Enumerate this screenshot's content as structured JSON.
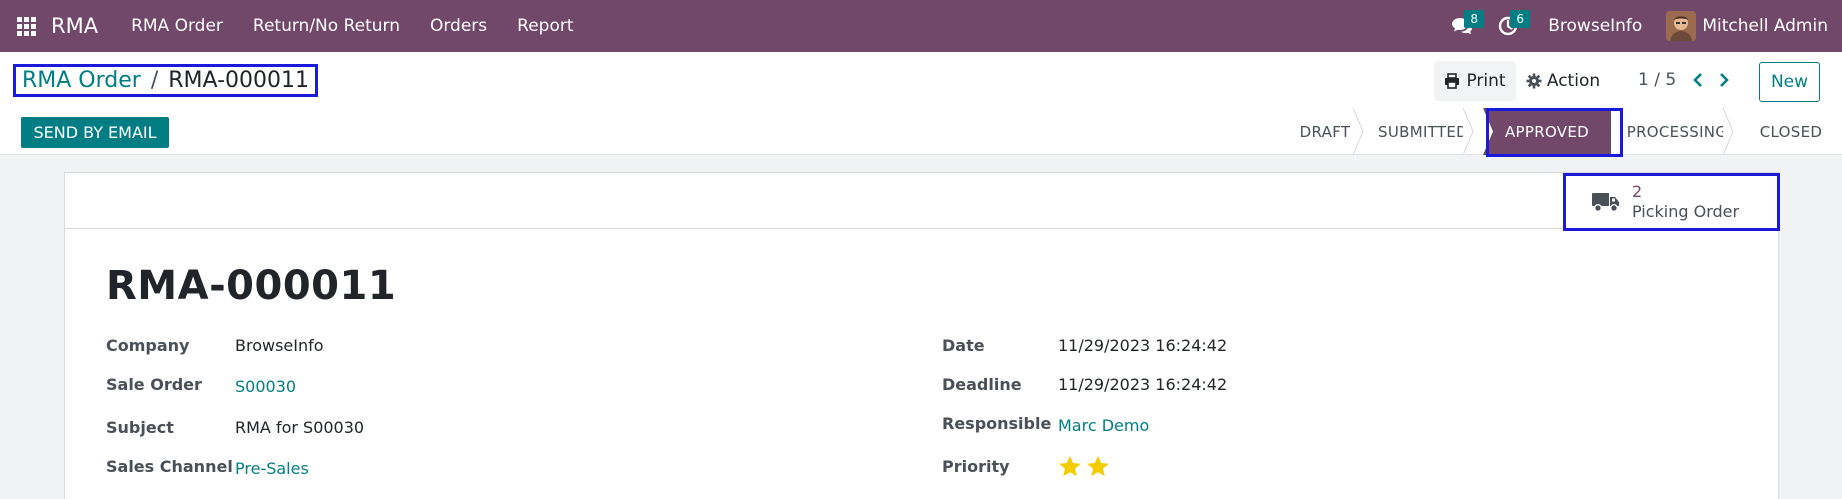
{
  "navbar": {
    "app_name": "RMA",
    "menu": [
      "RMA Order",
      "Return/No Return",
      "Orders",
      "Report"
    ],
    "messages_count": "8",
    "activities_count": "6",
    "company": "BrowseInfo",
    "user": "Mitchell Admin",
    "color": "#71476a"
  },
  "control": {
    "breadcrumb_parent": "RMA Order",
    "breadcrumb_sep": "/",
    "breadcrumb_current": "RMA-000011",
    "print_label": "Print",
    "action_label": "Action",
    "pager": "1 / 5",
    "new_label": "New",
    "send_email_label": "SEND BY EMAIL"
  },
  "statusbar": {
    "stages": [
      "DRAFT",
      "SUBMITTED",
      "APPROVED",
      "PROCESSING",
      "CLOSED"
    ],
    "active": "APPROVED"
  },
  "smart_button": {
    "count": "2",
    "label": "Picking Order"
  },
  "record": {
    "title": "RMA-000011",
    "left_fields": [
      {
        "label": "Company",
        "value": "BrowseInfo"
      },
      {
        "label": "Sale Order",
        "value": "S00030"
      },
      {
        "label": "Subject",
        "value": "RMA for S00030"
      },
      {
        "label": "Sales Channel",
        "value": "Pre-Sales"
      }
    ],
    "right_fields": [
      {
        "label": "Date",
        "value": "11/29/2023 16:24:42"
      },
      {
        "label": "Deadline",
        "value": "11/29/2023 16:24:42"
      },
      {
        "label": "Responsible",
        "value": "Marc Demo"
      },
      {
        "label": "Priority",
        "value": ""
      }
    ],
    "priority_stars": 2
  },
  "colors": {
    "accent": "#017e84",
    "brand": "#71476a",
    "highlight": "#1a1adb",
    "star": "#f3cc00"
  }
}
